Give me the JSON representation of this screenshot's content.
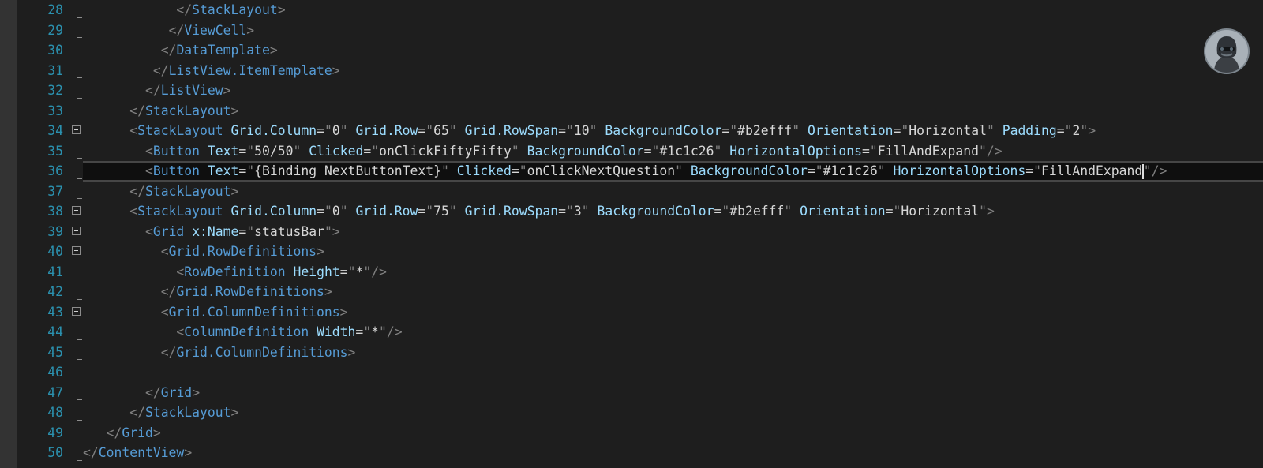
{
  "editor": {
    "first_line_number": 28,
    "current_line_index": 8,
    "lines": [
      {
        "n": "28",
        "indent": 12,
        "tokens": [
          [
            "delim",
            "</"
          ],
          [
            "el",
            "StackLayout"
          ],
          [
            "delim",
            ">"
          ]
        ]
      },
      {
        "n": "29",
        "indent": 11,
        "tokens": [
          [
            "delim",
            "</"
          ],
          [
            "el",
            "ViewCell"
          ],
          [
            "delim",
            ">"
          ]
        ]
      },
      {
        "n": "30",
        "indent": 10,
        "tokens": [
          [
            "delim",
            "</"
          ],
          [
            "el",
            "DataTemplate"
          ],
          [
            "delim",
            ">"
          ]
        ]
      },
      {
        "n": "31",
        "indent": 9,
        "tokens": [
          [
            "delim",
            "</"
          ],
          [
            "el",
            "ListView.ItemTemplate"
          ],
          [
            "delim",
            ">"
          ]
        ]
      },
      {
        "n": "32",
        "indent": 8,
        "tokens": [
          [
            "delim",
            "</"
          ],
          [
            "el",
            "ListView"
          ],
          [
            "delim",
            ">"
          ]
        ]
      },
      {
        "n": "33",
        "indent": 6,
        "tokens": [
          [
            "delim",
            "</"
          ],
          [
            "el",
            "StackLayout"
          ],
          [
            "delim",
            ">"
          ]
        ]
      },
      {
        "n": "34",
        "indent": 6,
        "tokens": [
          [
            "delim",
            "<"
          ],
          [
            "el",
            "StackLayout"
          ],
          [
            "text",
            " "
          ],
          [
            "attr",
            "Grid.Column"
          ],
          [
            "eq",
            "="
          ],
          [
            "delim",
            "\""
          ],
          [
            "val",
            "0"
          ],
          [
            "delim",
            "\""
          ],
          [
            "text",
            " "
          ],
          [
            "attr",
            "Grid.Row"
          ],
          [
            "eq",
            "="
          ],
          [
            "delim",
            "\""
          ],
          [
            "val",
            "65"
          ],
          [
            "delim",
            "\""
          ],
          [
            "text",
            " "
          ],
          [
            "attr",
            "Grid.RowSpan"
          ],
          [
            "eq",
            "="
          ],
          [
            "delim",
            "\""
          ],
          [
            "val",
            "10"
          ],
          [
            "delim",
            "\""
          ],
          [
            "text",
            " "
          ],
          [
            "attr",
            "BackgroundColor"
          ],
          [
            "eq",
            "="
          ],
          [
            "delim",
            "\""
          ],
          [
            "val",
            "#b2efff"
          ],
          [
            "delim",
            "\""
          ],
          [
            "text",
            " "
          ],
          [
            "attr",
            "Orientation"
          ],
          [
            "eq",
            "="
          ],
          [
            "delim",
            "\""
          ],
          [
            "val",
            "Horizontal"
          ],
          [
            "delim",
            "\""
          ],
          [
            "text",
            " "
          ],
          [
            "attr",
            "Padding"
          ],
          [
            "eq",
            "="
          ],
          [
            "delim",
            "\""
          ],
          [
            "val",
            "2"
          ],
          [
            "delim",
            "\""
          ],
          [
            "delim",
            ">"
          ]
        ]
      },
      {
        "n": "35",
        "indent": 8,
        "tokens": [
          [
            "delim",
            "<"
          ],
          [
            "el",
            "Button"
          ],
          [
            "text",
            " "
          ],
          [
            "attr",
            "Text"
          ],
          [
            "eq",
            "="
          ],
          [
            "delim",
            "\""
          ],
          [
            "val",
            "50/50"
          ],
          [
            "delim",
            "\""
          ],
          [
            "text",
            " "
          ],
          [
            "attr",
            "Clicked"
          ],
          [
            "eq",
            "="
          ],
          [
            "delim",
            "\""
          ],
          [
            "val",
            "onClickFiftyFifty"
          ],
          [
            "delim",
            "\""
          ],
          [
            "text",
            " "
          ],
          [
            "attr",
            "BackgroundColor"
          ],
          [
            "eq",
            "="
          ],
          [
            "delim",
            "\""
          ],
          [
            "val",
            "#1c1c26"
          ],
          [
            "delim",
            "\""
          ],
          [
            "text",
            " "
          ],
          [
            "attr",
            "HorizontalOptions"
          ],
          [
            "eq",
            "="
          ],
          [
            "delim",
            "\""
          ],
          [
            "val",
            "FillAndExpand"
          ],
          [
            "delim",
            "\""
          ],
          [
            "delim",
            "/>"
          ]
        ]
      },
      {
        "n": "36",
        "indent": 8,
        "tokens": [
          [
            "delim",
            "<"
          ],
          [
            "el",
            "Button"
          ],
          [
            "text",
            " "
          ],
          [
            "attr",
            "Text"
          ],
          [
            "eq",
            "="
          ],
          [
            "delim",
            "\""
          ],
          [
            "val",
            "{Binding NextButtonText}"
          ],
          [
            "delim",
            "\""
          ],
          [
            "text",
            " "
          ],
          [
            "attr",
            "Clicked"
          ],
          [
            "eq",
            "="
          ],
          [
            "delim",
            "\""
          ],
          [
            "val",
            "onClickNextQuestion"
          ],
          [
            "delim",
            "\""
          ],
          [
            "text",
            " "
          ],
          [
            "attr",
            "BackgroundColor"
          ],
          [
            "eq",
            "="
          ],
          [
            "delim",
            "\""
          ],
          [
            "val",
            "#1c1c26"
          ],
          [
            "delim",
            "\""
          ],
          [
            "text",
            " "
          ],
          [
            "attr",
            "HorizontalOptions"
          ],
          [
            "eq",
            "="
          ],
          [
            "delim",
            "\""
          ],
          [
            "val",
            "FillAndExpand"
          ],
          [
            "caret",
            ""
          ],
          [
            "delim",
            "\""
          ],
          [
            "delim",
            "/>"
          ]
        ]
      },
      {
        "n": "37",
        "indent": 6,
        "tokens": [
          [
            "delim",
            "</"
          ],
          [
            "el",
            "StackLayout"
          ],
          [
            "delim",
            ">"
          ]
        ]
      },
      {
        "n": "38",
        "indent": 6,
        "tokens": [
          [
            "delim",
            "<"
          ],
          [
            "el",
            "StackLayout"
          ],
          [
            "text",
            " "
          ],
          [
            "attr",
            "Grid.Column"
          ],
          [
            "eq",
            "="
          ],
          [
            "delim",
            "\""
          ],
          [
            "val",
            "0"
          ],
          [
            "delim",
            "\""
          ],
          [
            "text",
            " "
          ],
          [
            "attr",
            "Grid.Row"
          ],
          [
            "eq",
            "="
          ],
          [
            "delim",
            "\""
          ],
          [
            "val",
            "75"
          ],
          [
            "delim",
            "\""
          ],
          [
            "text",
            " "
          ],
          [
            "attr",
            "Grid.RowSpan"
          ],
          [
            "eq",
            "="
          ],
          [
            "delim",
            "\""
          ],
          [
            "val",
            "3"
          ],
          [
            "delim",
            "\""
          ],
          [
            "text",
            " "
          ],
          [
            "attr",
            "BackgroundColor"
          ],
          [
            "eq",
            "="
          ],
          [
            "delim",
            "\""
          ],
          [
            "val",
            "#b2efff"
          ],
          [
            "delim",
            "\""
          ],
          [
            "text",
            " "
          ],
          [
            "attr",
            "Orientation"
          ],
          [
            "eq",
            "="
          ],
          [
            "delim",
            "\""
          ],
          [
            "val",
            "Horizontal"
          ],
          [
            "delim",
            "\""
          ],
          [
            "delim",
            ">"
          ]
        ]
      },
      {
        "n": "39",
        "indent": 8,
        "tokens": [
          [
            "delim",
            "<"
          ],
          [
            "el",
            "Grid"
          ],
          [
            "text",
            " "
          ],
          [
            "attr",
            "x:Name"
          ],
          [
            "eq",
            "="
          ],
          [
            "delim",
            "\""
          ],
          [
            "val",
            "statusBar"
          ],
          [
            "delim",
            "\""
          ],
          [
            "delim",
            ">"
          ]
        ]
      },
      {
        "n": "40",
        "indent": 10,
        "tokens": [
          [
            "delim",
            "<"
          ],
          [
            "el",
            "Grid.RowDefinitions"
          ],
          [
            "delim",
            ">"
          ]
        ]
      },
      {
        "n": "41",
        "indent": 12,
        "tokens": [
          [
            "delim",
            "<"
          ],
          [
            "el",
            "RowDefinition"
          ],
          [
            "text",
            " "
          ],
          [
            "attr",
            "Height"
          ],
          [
            "eq",
            "="
          ],
          [
            "delim",
            "\""
          ],
          [
            "val",
            "*"
          ],
          [
            "delim",
            "\""
          ],
          [
            "delim",
            "/>"
          ]
        ]
      },
      {
        "n": "42",
        "indent": 10,
        "tokens": [
          [
            "delim",
            "</"
          ],
          [
            "el",
            "Grid.RowDefinitions"
          ],
          [
            "delim",
            ">"
          ]
        ]
      },
      {
        "n": "43",
        "indent": 10,
        "tokens": [
          [
            "delim",
            "<"
          ],
          [
            "el",
            "Grid.ColumnDefinitions"
          ],
          [
            "delim",
            ">"
          ]
        ]
      },
      {
        "n": "44",
        "indent": 12,
        "tokens": [
          [
            "delim",
            "<"
          ],
          [
            "el",
            "ColumnDefinition"
          ],
          [
            "text",
            " "
          ],
          [
            "attr",
            "Width"
          ],
          [
            "eq",
            "="
          ],
          [
            "delim",
            "\""
          ],
          [
            "val",
            "*"
          ],
          [
            "delim",
            "\""
          ],
          [
            "delim",
            "/>"
          ]
        ]
      },
      {
        "n": "45",
        "indent": 10,
        "tokens": [
          [
            "delim",
            "</"
          ],
          [
            "el",
            "Grid.ColumnDefinitions"
          ],
          [
            "delim",
            ">"
          ]
        ]
      },
      {
        "n": "46",
        "indent": 0,
        "tokens": []
      },
      {
        "n": "47",
        "indent": 8,
        "tokens": [
          [
            "delim",
            "</"
          ],
          [
            "el",
            "Grid"
          ],
          [
            "delim",
            ">"
          ]
        ]
      },
      {
        "n": "48",
        "indent": 6,
        "tokens": [
          [
            "delim",
            "</"
          ],
          [
            "el",
            "StackLayout"
          ],
          [
            "delim",
            ">"
          ]
        ]
      },
      {
        "n": "49",
        "indent": 3,
        "tokens": [
          [
            "delim",
            "</"
          ],
          [
            "el",
            "Grid"
          ],
          [
            "delim",
            ">"
          ]
        ]
      },
      {
        "n": "50",
        "indent": 0,
        "tokens": [
          [
            "delim",
            "</"
          ],
          [
            "el",
            "ContentView"
          ],
          [
            "delim",
            ">"
          ]
        ]
      }
    ],
    "fold_boxes": [
      "34",
      "38",
      "39",
      "40",
      "43"
    ],
    "colors": {
      "background": "#1e1e1e",
      "line_number": "#2b91af",
      "element": "#569cd6",
      "attribute": "#9cdcfe",
      "value": "#d7d7d7",
      "delimiter": "#808080"
    }
  },
  "avatar": {
    "icon": "user-avatar-icon"
  }
}
